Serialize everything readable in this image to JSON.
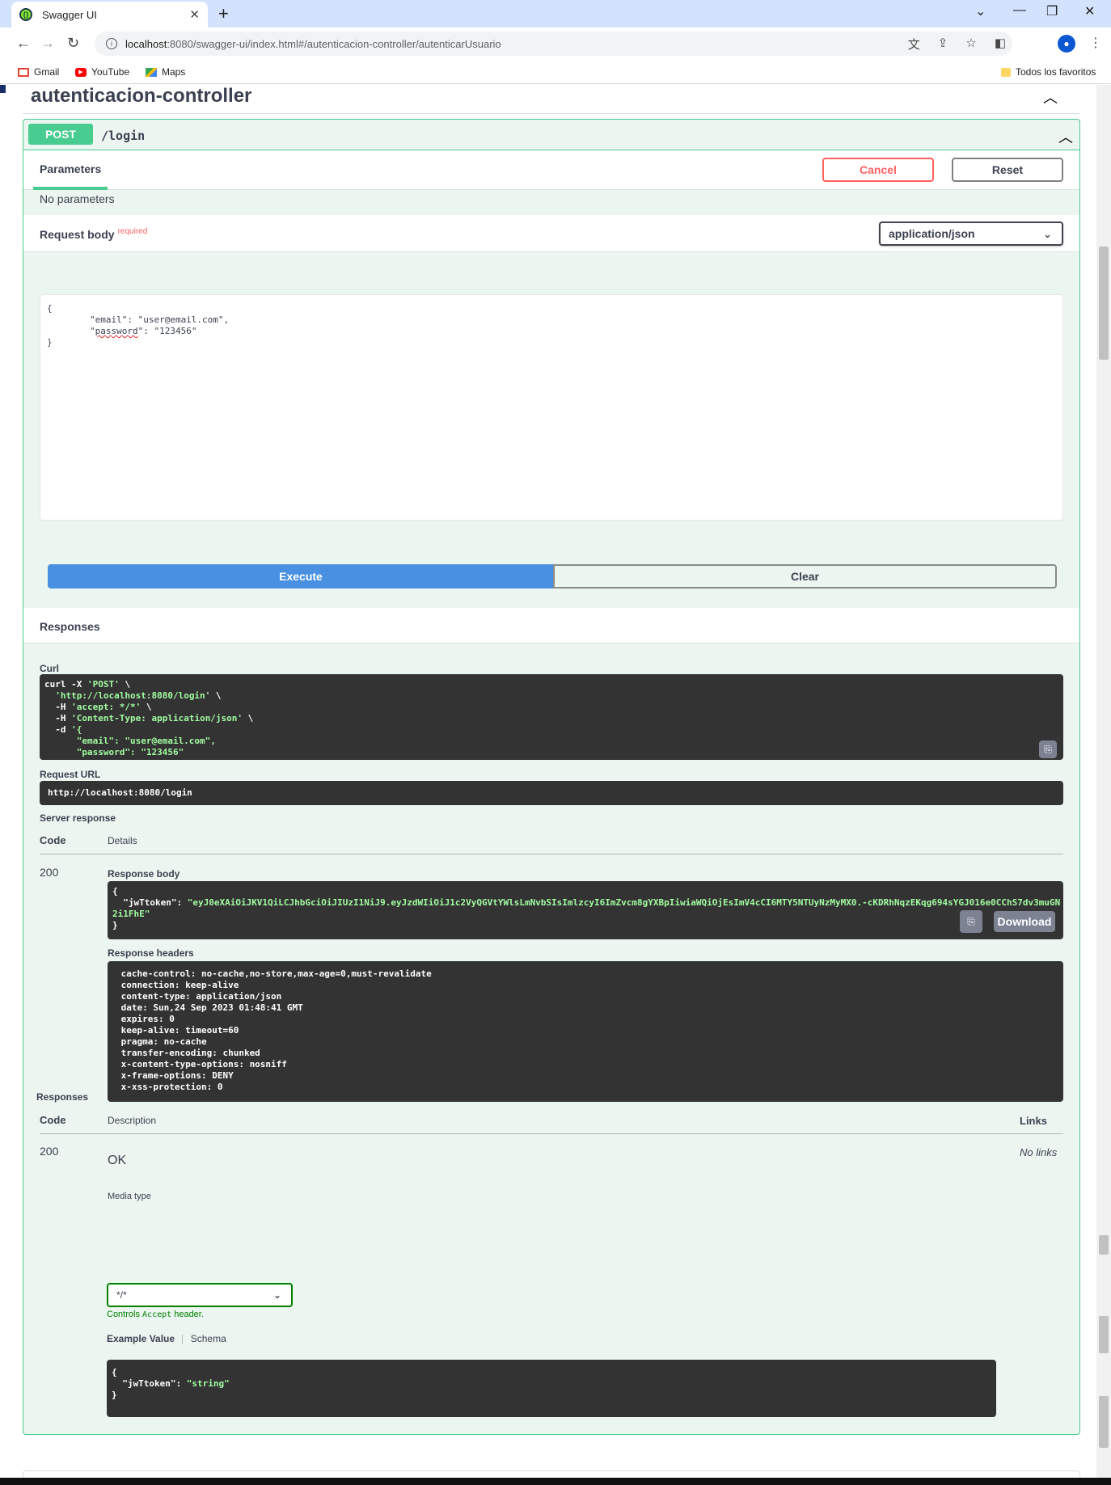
{
  "browser": {
    "tab_title": "Swagger UI",
    "url_host": "localhost",
    "url_path": ":8080/swagger-ui/index.html#/autenticacion-controller/autenticarUsuario",
    "bookmarks": [
      "Gmail",
      "YouTube",
      "Maps"
    ],
    "all_bookmarks": "Todos los favoritos"
  },
  "section": {
    "title": "autenticacion-controller"
  },
  "operation": {
    "method": "POST",
    "path": "/login",
    "parameters_tab": "Parameters",
    "cancel_label": "Cancel",
    "reset_label": "Reset",
    "no_parameters": "No parameters",
    "request_body_label": "Request body",
    "required_label": "required",
    "content_type": "application/json",
    "body_lines": [
      "{",
      "\t\"email\": \"user@email.com\",",
      "\t\"password\": \"123456\"",
      "}"
    ],
    "execute_label": "Execute",
    "clear_label": "Clear"
  },
  "responses_live": {
    "header": "Responses",
    "curl_label": "Curl",
    "curl_lines": [
      {
        "a": "curl -X ",
        "s": "'POST'",
        "b": " \\"
      },
      {
        "a": "  ",
        "s": "'http://localhost:8080/login'",
        "b": " \\"
      },
      {
        "a": "  -H ",
        "s": "'accept: */*'",
        "b": " \\"
      },
      {
        "a": "  -H ",
        "s": "'Content-Type: application/json'",
        "b": " \\"
      },
      {
        "a": "  -d ",
        "s": "'{",
        "b": ""
      },
      {
        "a": "",
        "s": "\t\"email\": \"user@email.com\",",
        "b": ""
      },
      {
        "a": "",
        "s": "\t\"password\": \"123456\"",
        "b": ""
      },
      {
        "a": "",
        "s": "}'",
        "b": ""
      }
    ],
    "request_url_label": "Request URL",
    "request_url": "http://localhost:8080/login",
    "server_response_label": "Server response",
    "code_col": "Code",
    "details_col": "Details",
    "code": "200",
    "response_body_label": "Response body",
    "response_body_open": "{",
    "response_key": "  \"jwTtoken\": ",
    "response_token": "\"eyJ0eXAiOiJKV1QiLCJhbGciOiJIUzI1NiJ9.eyJzdWIiOiJ1c2VyQGVtYWlsLmNvbSIsImlzcyI6ImZvcm8gYXBpIiwiaWQiOjEsImV4cCI6MTY5NTUyNzMyMX0.-cKDRhNqzEKqg694sYGJ016e0CChS7dv3muGN",
    "response_token_cont": "2i1FhE\"",
    "response_body_close": "}",
    "download_label": "Download",
    "response_headers_label": "Response headers",
    "response_headers": [
      " cache-control: no-cache,no-store,max-age=0,must-revalidate",
      " connection: keep-alive",
      " content-type: application/json",
      " date: Sun,24 Sep 2023 01:48:41 GMT",
      " expires: 0",
      " keep-alive: timeout=60",
      " pragma: no-cache",
      " transfer-encoding: chunked",
      " x-content-type-options: nosniff",
      " x-frame-options: DENY",
      " x-xss-protection: 0"
    ]
  },
  "responses_doc": {
    "header": "Responses",
    "code_col": "Code",
    "description_col": "Description",
    "links_col": "Links",
    "code": "200",
    "description": "OK",
    "links": "No links",
    "media_type_label": "Media type",
    "media_type": "*/*",
    "controls_pre": "Controls ",
    "controls_code": "Accept",
    "controls_post": " header.",
    "example_value_tab": "Example Value",
    "schema_tab": "Schema",
    "example_open": "{",
    "example_key": "  \"jwTtoken\": ",
    "example_val": "\"string\"",
    "example_close": "}"
  },
  "colors": {
    "post_green": "#49cc90",
    "execute_blue": "#4990e2",
    "cancel_red": "#ff6060"
  }
}
